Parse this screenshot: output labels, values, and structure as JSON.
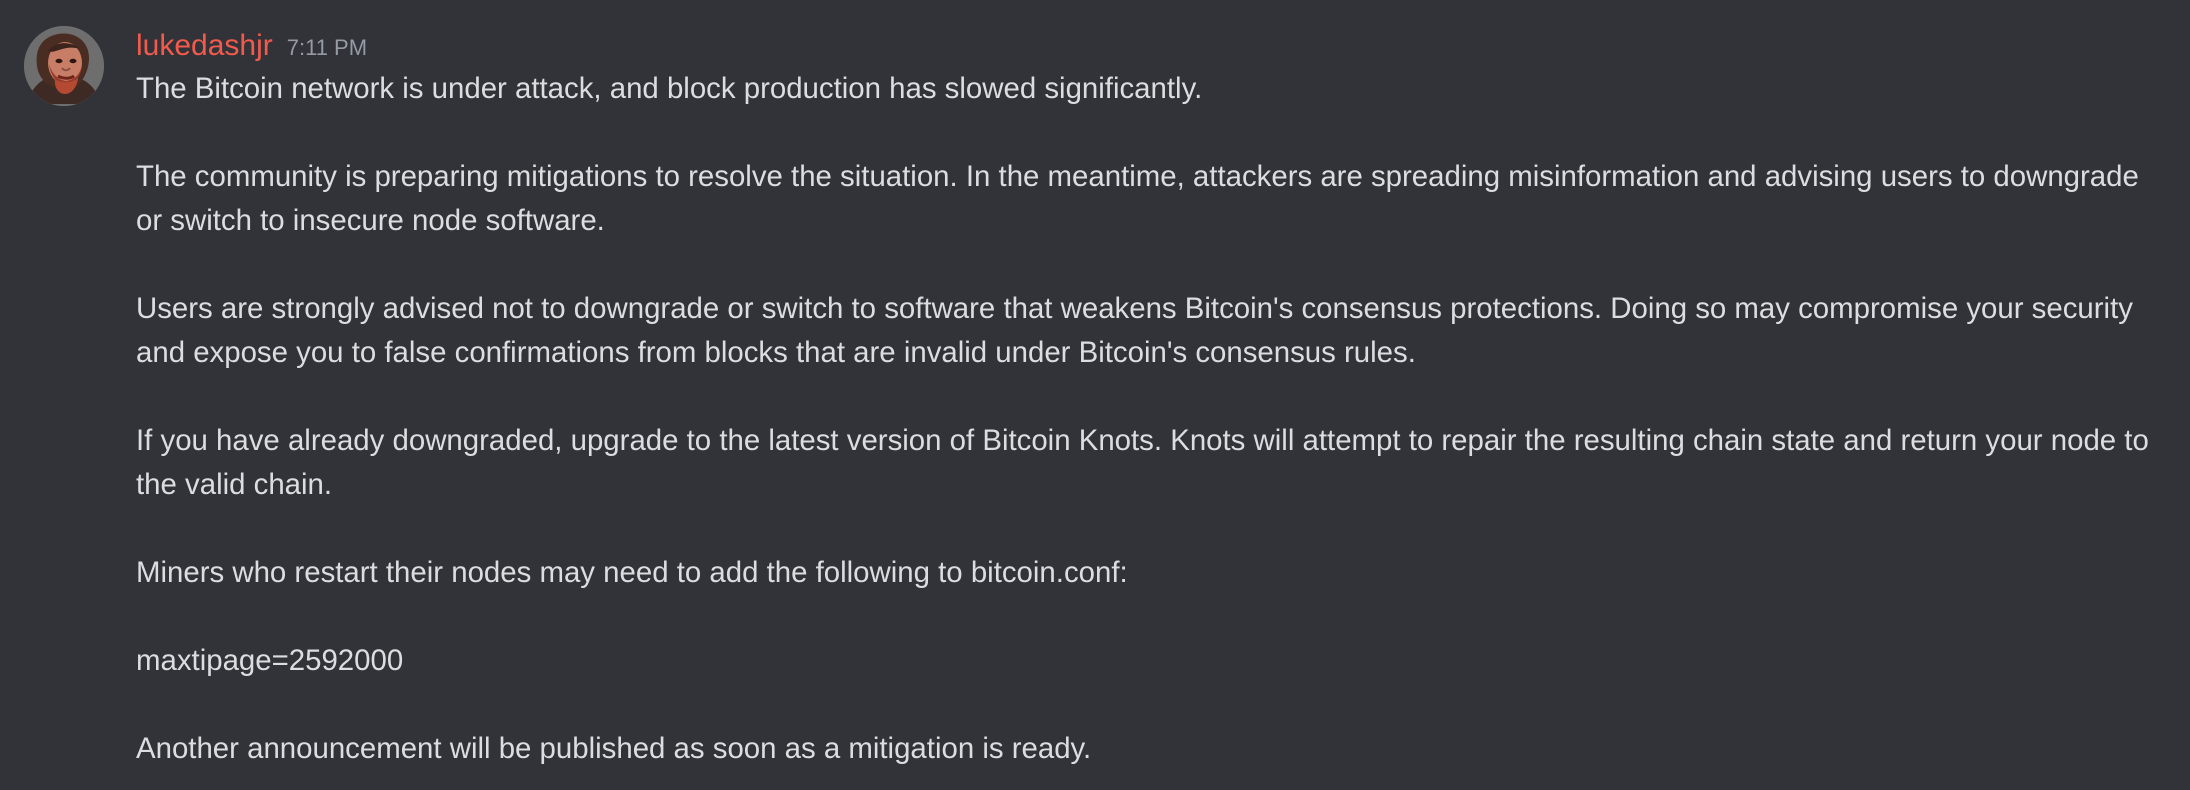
{
  "message": {
    "author": {
      "name": "lukedashjr",
      "name_color": "#f25a4c"
    },
    "timestamp": "7:11 PM",
    "paragraphs": [
      "The Bitcoin network is under attack, and block production has slowed significantly.",
      "The community is preparing mitigations to resolve the situation. In the meantime, attackers are spreading misinformation and advising users to downgrade or switch to insecure node software.",
      "Users are strongly advised not to downgrade or switch to software that weakens Bitcoin's consensus protections. Doing so may compromise your security and expose you to false confirmations from blocks that are invalid under Bitcoin's consensus rules.",
      "If you have already downgraded, upgrade to the latest version of Bitcoin Knots. Knots will attempt to repair the resulting chain state and return your node to the valid chain.",
      "Miners who restart their nodes may need to add the following to bitcoin.conf:",
      "maxtipage=2592000",
      "Another announcement will be published as soon as a mitigation is ready."
    ]
  },
  "colors": {
    "background": "#313338",
    "text": "#dbdee1",
    "muted": "#949ba4"
  },
  "icons": {
    "avatar": "user-avatar-photo"
  }
}
